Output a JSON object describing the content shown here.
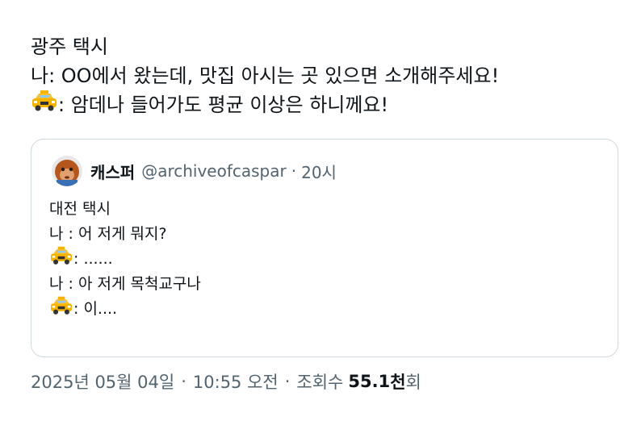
{
  "tweet": {
    "lines": {
      "line1": "광주 택시",
      "line2": "나: OO에서 왔는데, 맛집 아시는 곳 있으면 소개해주세요!",
      "line3_suffix": ": 암데나 들어가도 평균 이상은 하니께요!"
    },
    "taxi_icon": "taxi-emoji-icon"
  },
  "quote": {
    "author_name": "캐스퍼",
    "author_handle": "@archiveofcaspar",
    "separator": "·",
    "time": "20시",
    "avatar_icon": "orangutan-avatar-icon",
    "lines": {
      "l1": "대전 택시",
      "l2": "나 : 어 저게 뭐지?",
      "l3_suffix": " : ......",
      "l4": "나 : 아 저게 목척교구나",
      "l5_suffix": " : 이...."
    }
  },
  "meta": {
    "datetime": "2025년 05월 04일",
    "separator1": "·",
    "time": "10:55 오전",
    "separator2": "·",
    "views_label": "조회수",
    "views_number": "55.1",
    "views_unit": "천",
    "views_suffix": "회"
  },
  "colors": {
    "text": "#0f1419",
    "secondary": "#536471",
    "border": "#cfd9de",
    "taxi_yellow": "#f4b400"
  }
}
